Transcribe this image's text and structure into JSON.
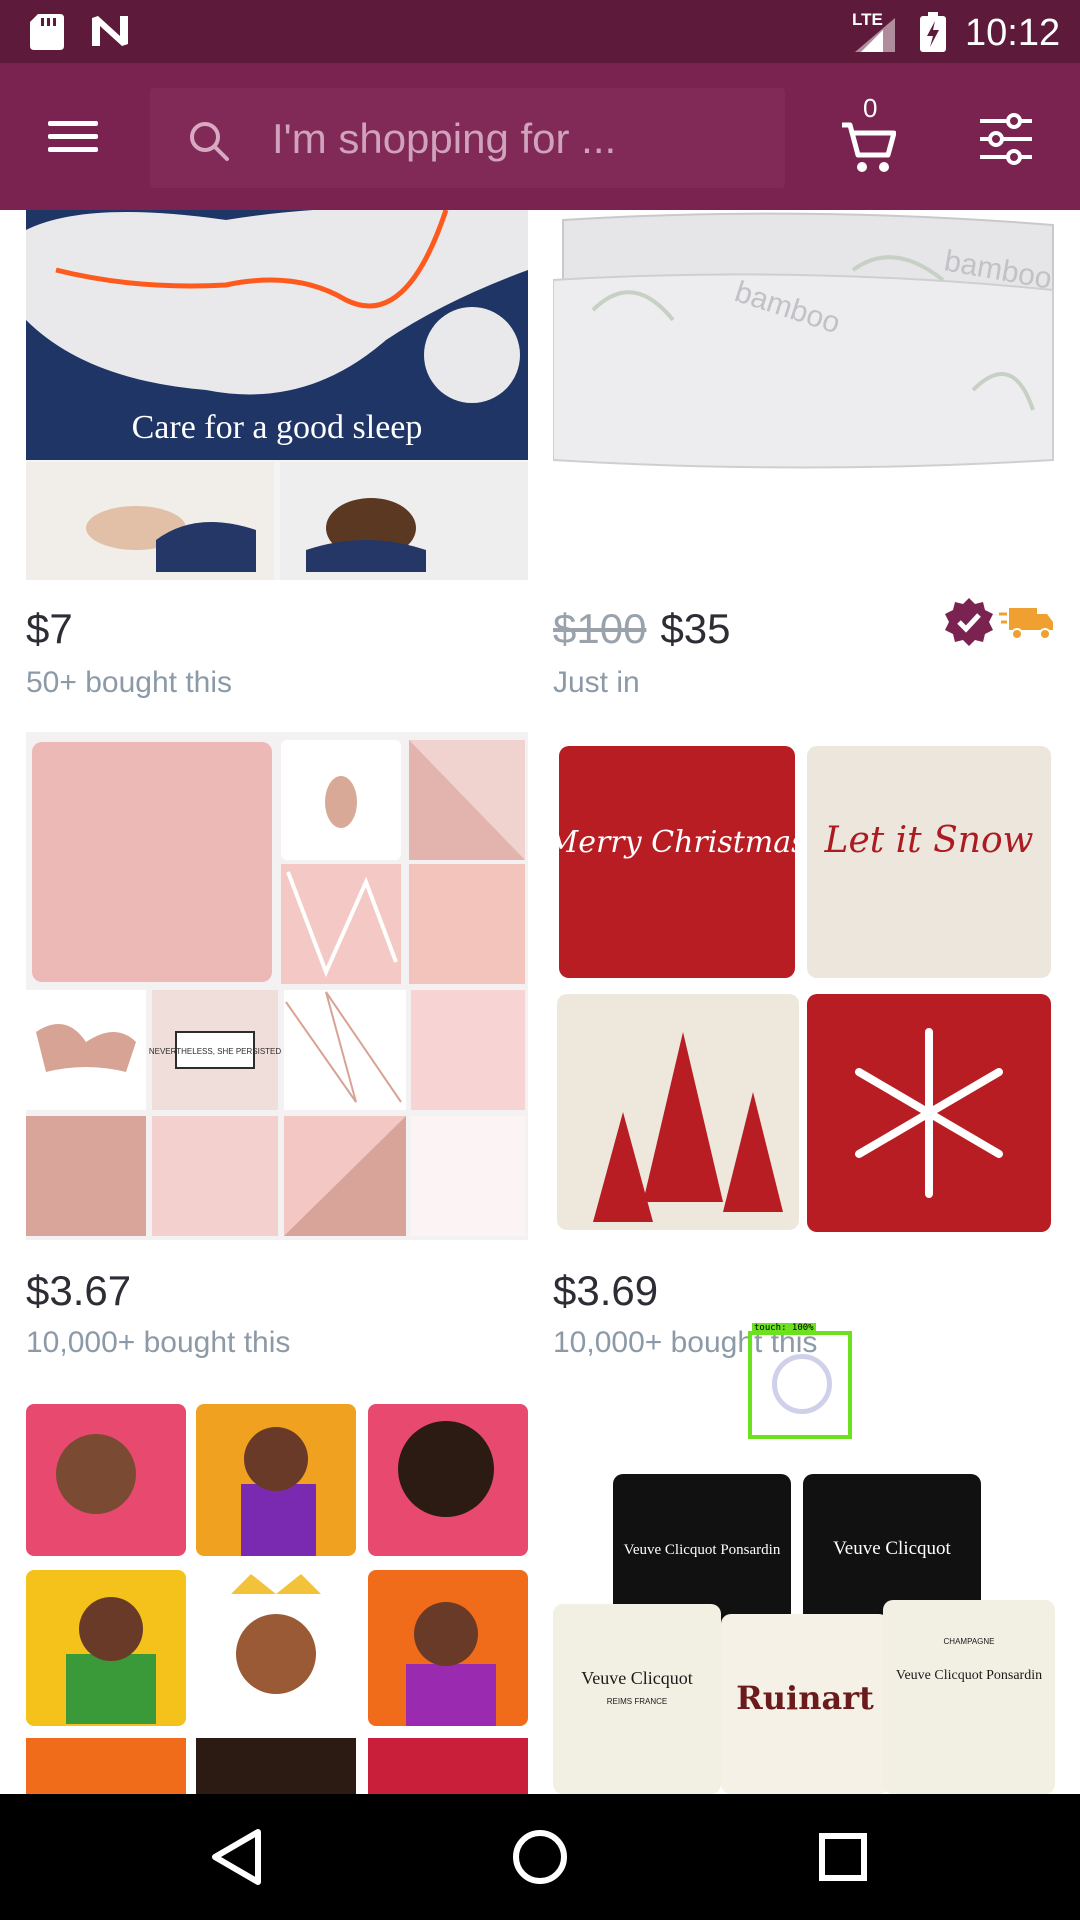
{
  "status_bar": {
    "network": "LTE",
    "time": "10:12"
  },
  "app_bar": {
    "search": {
      "placeholder": "I'm shopping for ..."
    },
    "cart_count": "0"
  },
  "products": [
    {
      "price": "$7",
      "original_price": "",
      "subtext": "50+ bought this",
      "image_text": "Care for a good sleep"
    },
    {
      "price": "$35",
      "original_price": "$100",
      "subtext": "Just in",
      "image_text": "bamboo"
    },
    {
      "price": "$3.67",
      "original_price": "",
      "subtext": "10,000+ bought this",
      "image_text": "NEVERTHELESS, SHE PERSISTED"
    },
    {
      "price": "$3.69",
      "original_price": "",
      "subtext": "10,000+ bought this",
      "image_text": [
        "Merry Christmas",
        "Let it Snow"
      ]
    },
    {
      "price": "",
      "original_price": "",
      "subtext": "",
      "image_text": ""
    },
    {
      "price": "",
      "original_price": "",
      "subtext": "",
      "image_text": [
        "Veuve Clicquot Ponsardin",
        "Veuve Clicquot",
        "Ruinart",
        "CHAMPAGNE",
        "REIMS FRANCE"
      ]
    }
  ],
  "touch_overlay": "touch: 100%",
  "colors": {
    "status_bar": "#5e1a3b",
    "app_bar": "#7a2350",
    "badge_purple": "#7a2350",
    "delivery_orange": "#f0a030"
  }
}
